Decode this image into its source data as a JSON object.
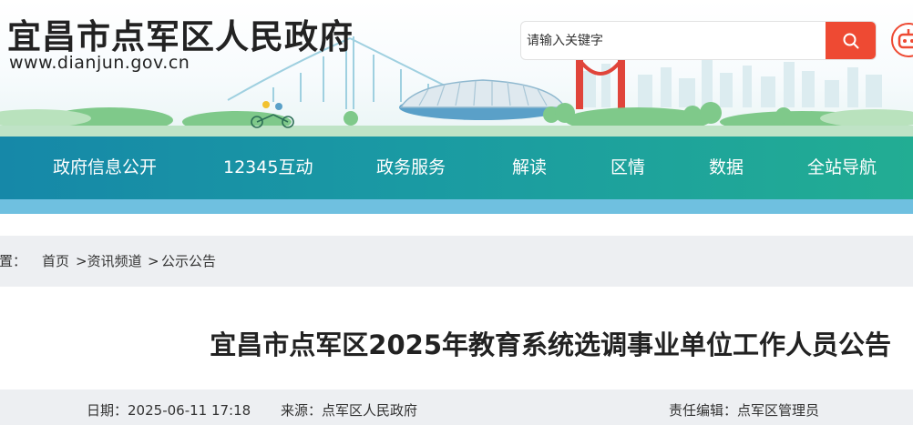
{
  "header": {
    "site_title": "宜昌市点军区人民政府",
    "site_url": "www.dianjun.gov.cn",
    "search": {
      "placeholder": "请输入关键字"
    },
    "icons": {
      "search": "search-icon",
      "assistant": "robot-icon"
    },
    "colors": {
      "search_button": "#ee4a33",
      "nav_start": "#1688a8",
      "nav_end": "#22ad93"
    }
  },
  "nav": {
    "items": [
      {
        "label": "政府信息公开"
      },
      {
        "label": "12345互动"
      },
      {
        "label": "政务服务"
      },
      {
        "label": "解读"
      },
      {
        "label": "区情"
      },
      {
        "label": "数据"
      },
      {
        "label": "全站导航"
      }
    ]
  },
  "breadcrumb": {
    "prefix": "位置：",
    "items": [
      "首页",
      ">资讯频道",
      ">",
      "公示公告"
    ]
  },
  "article": {
    "title": "宜昌市点军区2025年教育系统选调事业单位工作人员公告",
    "date_label": "日期：",
    "date": "2025-06-11 17:18",
    "source_label": "来源：",
    "source": "点军区人民政府",
    "editor_label": "责任编辑：",
    "editor": "点军区管理员"
  }
}
